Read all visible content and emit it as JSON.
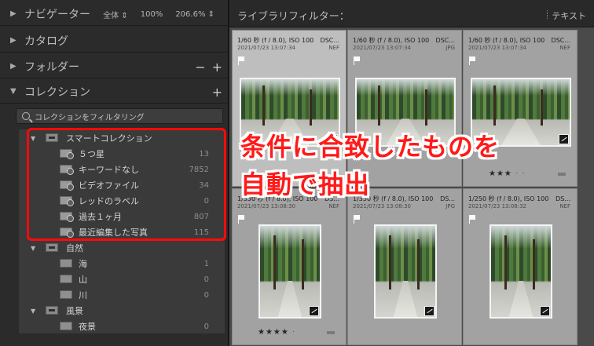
{
  "navigator": {
    "title": "ナビゲーター",
    "opt_all": "全体 ⇕",
    "opt_100": "100%",
    "opt_zoom": "206.6% ⇕"
  },
  "catalog": {
    "title": "カタログ"
  },
  "folders": {
    "title": "フォルダー",
    "minus": "−",
    "plus": "+"
  },
  "collections": {
    "title": "コレクション",
    "plus": "+",
    "filter_text": "コレクションをフィルタリング"
  },
  "tree": [
    {
      "kind": "set",
      "label": "スマートコレクション",
      "count": ""
    },
    {
      "kind": "smart",
      "label": "５つ星",
      "count": "13"
    },
    {
      "kind": "smart",
      "label": "キーワードなし",
      "count": "7852"
    },
    {
      "kind": "smart",
      "label": "ビデオファイル",
      "count": "34"
    },
    {
      "kind": "smart",
      "label": "レッドのラベル",
      "count": "0"
    },
    {
      "kind": "smart",
      "label": "過去１ヶ月",
      "count": "807"
    },
    {
      "kind": "smart",
      "label": "最近編集した写真",
      "count": "115"
    },
    {
      "kind": "set",
      "label": "自然",
      "count": ""
    },
    {
      "kind": "col",
      "label": "海",
      "count": "1"
    },
    {
      "kind": "col",
      "label": "山",
      "count": "0"
    },
    {
      "kind": "col",
      "label": "川",
      "count": "0"
    },
    {
      "kind": "set",
      "label": "風景",
      "count": ""
    },
    {
      "kind": "col",
      "label": "夜景",
      "count": "0"
    }
  ],
  "library_filter": {
    "title": "ライブラリフィルター：",
    "text_tab": "テキスト"
  },
  "cells": [
    {
      "l1": "1/60 秒 (f / 8.0), ISO 100",
      "ext": "DSC...",
      "l2": "2021/07/23 13:07:34",
      "ftype": "NEF",
      "stars": "",
      "dim": "",
      "sel": true
    },
    {
      "l1": "1/60 秒 (f / 8.0), ISO 100",
      "ext": "DSC...",
      "l2": "2021/07/23 13:07:34",
      "ftype": "JPG",
      "stars": "",
      "dim": "",
      "sel": false
    },
    {
      "l1": "1/60 秒 (f / 8.0), ISO 100",
      "ext": "DSC...",
      "l2": "2021/07/23 13:07:34",
      "ftype": "NEF",
      "stars": "★★★",
      "dim": " · ·",
      "sel": false
    },
    {
      "l1": "1/350 秒 (f / 8.0), ISO 100",
      "ext": "DS...",
      "l2": "2021/07/23 13:08:30",
      "ftype": "NEF",
      "stars": "★★★★",
      "dim": " ·",
      "sel": false
    },
    {
      "l1": "1/350 秒 (f / 8.0), ISO 100",
      "ext": "DS...",
      "l2": "2021/07/23 13:08:30",
      "ftype": "JPG",
      "stars": "",
      "dim": "",
      "sel": false
    },
    {
      "l1": "1/250 秒 (f / 8.0), ISO 100",
      "ext": "DS...",
      "l2": "2021/07/23 13:08:32",
      "ftype": "NEF",
      "stars": "",
      "dim": "",
      "sel": false
    }
  ],
  "grid_stars_partial": "★★",
  "callout": {
    "line1": "条件に合致したものを",
    "line2": "自動で抽出"
  },
  "colors": {
    "highlight": "#ff0a0a",
    "panel": "#2b2b2b",
    "grid": "#a2a2a2"
  }
}
